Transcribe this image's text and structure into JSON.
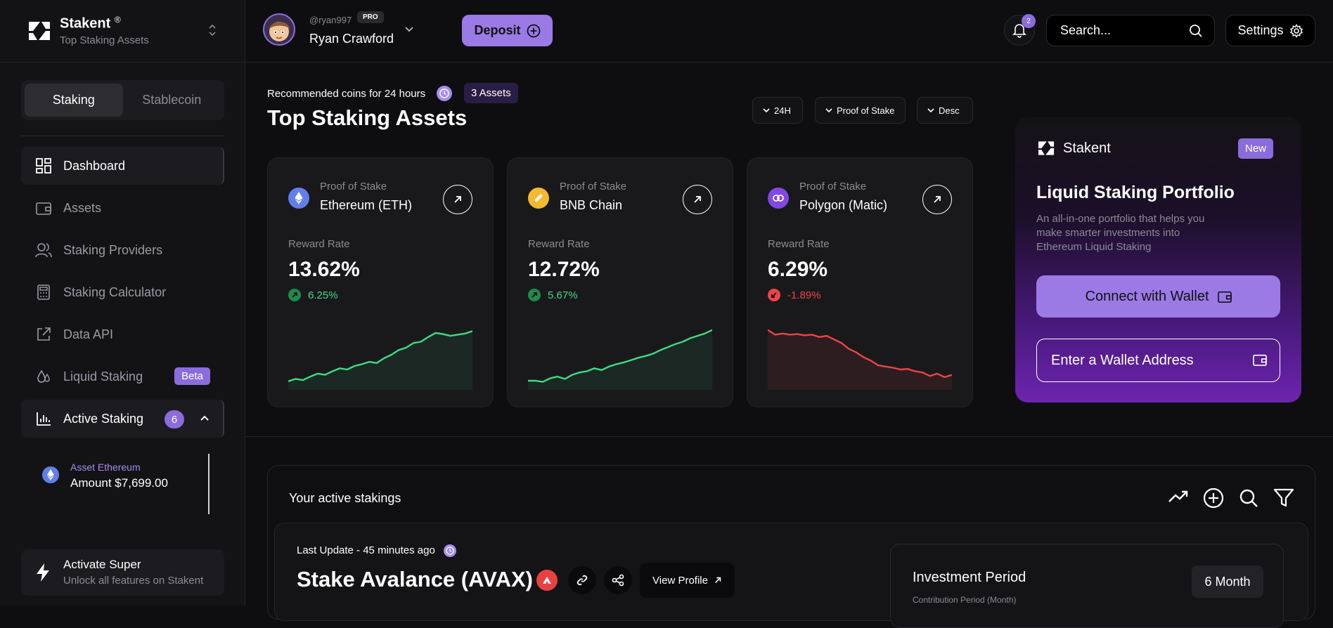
{
  "brand": {
    "name": "Stakent",
    "reg": "®",
    "subtitle": "Top Staking Assets"
  },
  "sidebar": {
    "tabs": [
      "Staking",
      "Stablecoin"
    ],
    "items": [
      {
        "label": "Dashboard",
        "icon": "dashboard-icon"
      },
      {
        "label": "Assets",
        "icon": "wallet-icon"
      },
      {
        "label": "Staking Providers",
        "icon": "users-icon"
      },
      {
        "label": "Staking Calculator",
        "icon": "calculator-icon"
      },
      {
        "label": "Data API",
        "icon": "external-link-icon"
      },
      {
        "label": "Liquid Staking",
        "icon": "droplets-icon",
        "badge": "Beta"
      },
      {
        "label": "Active Staking",
        "icon": "bar-chart-icon",
        "count": "6"
      }
    ],
    "active_sub": {
      "label": "Asset Ethereum",
      "amount": "Amount $7,699.00"
    },
    "activate": {
      "title": "Activate Super",
      "subtitle": "Unlock all features on Stakent"
    }
  },
  "header": {
    "handle": "@ryan997",
    "pro": "PRO",
    "user_name": "Ryan Crawford",
    "deposit": "Deposit",
    "notif_count": "2",
    "search_placeholder": "Search...",
    "settings": "Settings"
  },
  "main": {
    "recommended": "Recommended coins for 24 hours",
    "assets_badge": "3 Assets",
    "title": "Top Staking Assets",
    "filters": [
      "24H",
      "Proof of Stake",
      "Desc"
    ]
  },
  "cards": [
    {
      "category": "Proof of Stake",
      "name": "Ethereum (ETH)",
      "reward_label": "Reward Rate",
      "value": "13.62%",
      "change": "6.25%",
      "trend": "up",
      "coin_color": "#627eea",
      "spark": [
        5,
        9,
        7,
        13,
        18,
        16,
        22,
        27,
        25,
        31,
        34,
        38,
        36,
        44,
        50,
        58,
        62,
        70,
        72,
        80,
        87,
        85,
        82,
        84,
        86,
        90
      ]
    },
    {
      "category": "Proof of Stake",
      "name": "BNB Chain",
      "reward_label": "Reward Rate",
      "value": "12.72%",
      "change": "5.67%",
      "trend": "up",
      "coin_color": "#f3ba2f",
      "spark": [
        6,
        6,
        4,
        10,
        13,
        9,
        16,
        20,
        22,
        27,
        24,
        30,
        34,
        37,
        41,
        45,
        48,
        52,
        58,
        63,
        68,
        72,
        78,
        82,
        86,
        92
      ]
    },
    {
      "category": "Proof of Stake",
      "name": "Polygon (Matic)",
      "reward_label": "Reward Rate",
      "value": "6.29%",
      "change": "-1.89%",
      "trend": "down",
      "coin_color": "#8247e5",
      "spark": [
        92,
        84,
        86,
        84,
        85,
        83,
        84,
        80,
        82,
        76,
        70,
        60,
        54,
        46,
        40,
        32,
        30,
        28,
        25,
        26,
        22,
        20,
        14,
        18,
        12,
        16
      ]
    }
  ],
  "promo": {
    "brand": "Stakent",
    "new": "New",
    "title": "Liquid Staking Portfolio",
    "desc": "An all-in-one portfolio that helps you make smarter investments into Ethereum Liquid Staking",
    "connect": "Connect with Wallet",
    "enter": "Enter a Wallet Address"
  },
  "active_stakings": {
    "title": "Your active stakings",
    "last_update": "Last Update - 45 minutes ago",
    "stake_title": "Stake Avalance (AVAX)",
    "view_profile": "View Profile",
    "investment_period": "Investment Period",
    "contribution": "Contribution Period (Month)",
    "period_value": "6 Month"
  },
  "colors": {
    "accent": "#8b6cdc",
    "up": "#3ddc84",
    "down": "#ef4444",
    "bg": "#0e0e10"
  }
}
